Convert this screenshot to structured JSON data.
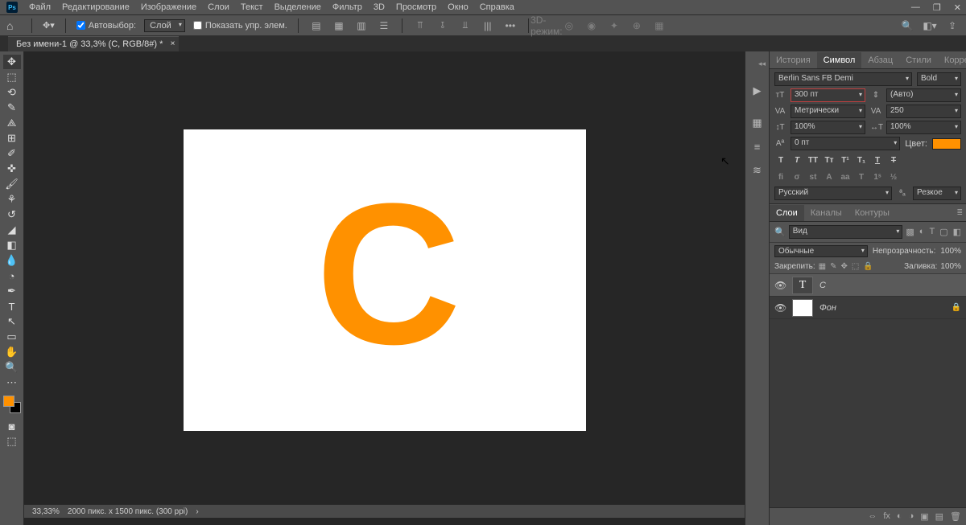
{
  "menu": {
    "items": [
      "Файл",
      "Редактирование",
      "Изображение",
      "Слои",
      "Текст",
      "Выделение",
      "Фильтр",
      "3D",
      "Просмотр",
      "Окно",
      "Справка"
    ]
  },
  "options_bar": {
    "auto_select": "Автовыбор:",
    "layer_dd": "Слой",
    "show_controls": "Показать упр. элем.",
    "mode_3d": "3D-режим:"
  },
  "doc_tab": {
    "title": "Без имени-1 @ 33,3% (C, RGB/8#) *"
  },
  "character_panel": {
    "tabs": [
      "История",
      "Символ",
      "Абзац",
      "Стили",
      "Коррекция"
    ],
    "font_family": "Berlin Sans FB Demi",
    "font_style": "Bold",
    "font_size": "300 пт",
    "leading": "(Авто)",
    "kerning": "Метрически",
    "tracking": "250",
    "vscale": "100%",
    "hscale": "100%",
    "baseline": "0 пт",
    "color_label": "Цвет:",
    "language": "Русский",
    "aa": "Резкое"
  },
  "layers_panel": {
    "tabs": [
      "Слои",
      "Каналы",
      "Контуры"
    ],
    "search_ph": "Вид",
    "blend_mode": "Обычные",
    "opacity_label": "Непрозрачность:",
    "opacity_val": "100%",
    "lock_label": "Закрепить:",
    "fill_label": "Заливка:",
    "fill_val": "100%",
    "layers": [
      {
        "name": "C",
        "type": "text",
        "selected": true,
        "locked": false
      },
      {
        "name": "Фон",
        "type": "bg",
        "selected": false,
        "locked": true
      }
    ]
  },
  "status": {
    "zoom": "33,33%",
    "info": "2000 пикс. x 1500 пикс. (300 ppi)"
  },
  "canvas": {
    "letter": "C"
  }
}
